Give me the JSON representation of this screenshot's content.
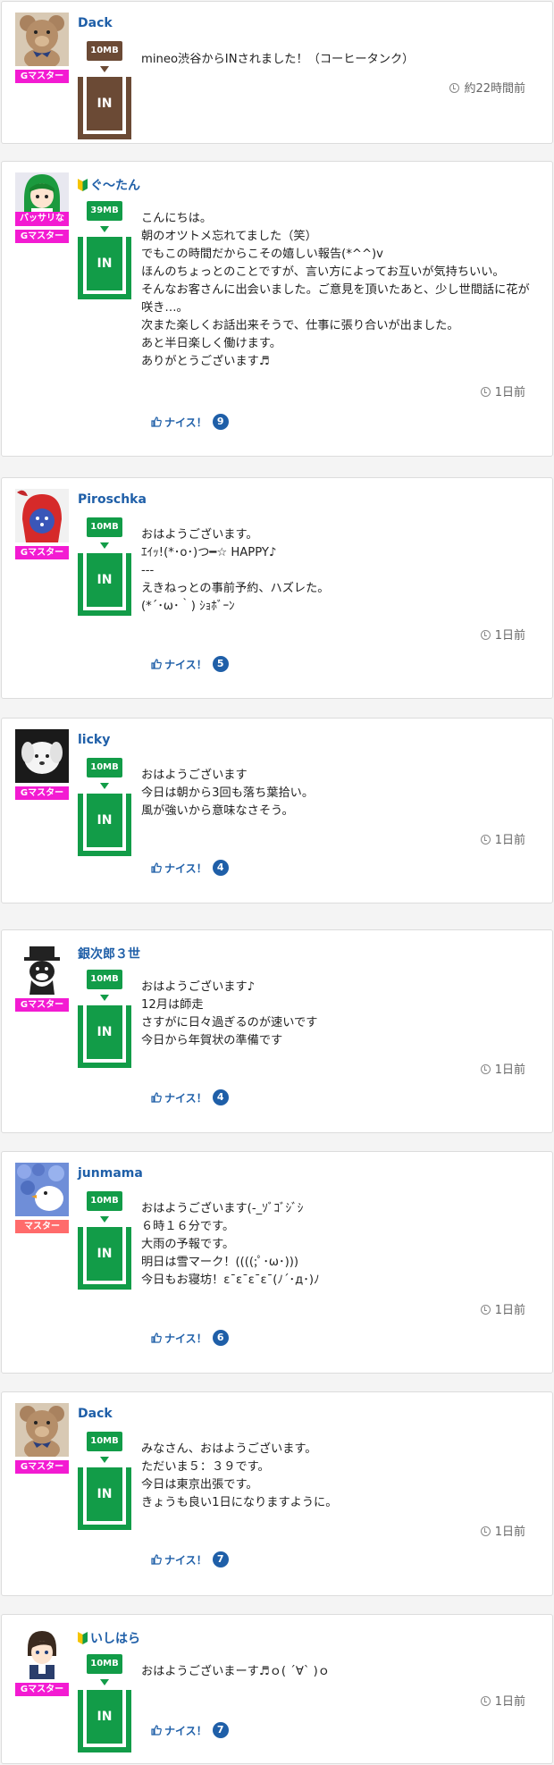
{
  "colors": {
    "link": "#1f5fa8",
    "in_green": "#129c48",
    "in_brown": "#6b4a35",
    "gmaster_magenta": "#f31bd2",
    "master_pink": "#ff6b6b"
  },
  "posts": [
    {
      "username": "Dack",
      "beginner": false,
      "avatar_icon": "teddy-bear-avatar",
      "avatar_caption": "",
      "rank": "Gマスター",
      "rank_color": "#f31bd2",
      "mb": "10MB",
      "mb_color": "#6b4a35",
      "in_label": "IN",
      "in_color": "#6b4a35",
      "message": "mineo渋谷からINされました！（コーヒータンク）",
      "time": "約22時間前",
      "nice_label": "",
      "nice_count": ""
    },
    {
      "username": "ぐ〜たん",
      "beginner": true,
      "avatar_icon": "green-hair-girl-avatar",
      "avatar_caption": "バッサリな",
      "rank": "Gマスター",
      "rank_color": "#f31bd2",
      "mb": "39MB",
      "mb_color": "#129c48",
      "in_label": "IN",
      "in_color": "#129c48",
      "message": "こんにちは。\n朝のオツトメ忘れてました（笑）\nでもこの時間だからこその嬉しい報告(*^^)v\nほんのちょっとのことですが、言い方によってお互いが気持ちいい。\nそんなお客さんに出会いました。ご意見を頂いたあと、少し世間話に花が咲き…。\n次また楽しくお話出来そうで、仕事に張り合いが出ました。\nあと半日楽しく働けます。\nありがとうございます♬",
      "time": "1日前",
      "nice_label": "ナイス！",
      "nice_count": "9"
    },
    {
      "username": "Piroschka",
      "beginner": false,
      "avatar_icon": "red-hood-avatar",
      "avatar_caption": "",
      "rank": "Gマスター",
      "rank_color": "#f31bd2",
      "mb": "10MB",
      "mb_color": "#129c48",
      "in_label": "IN",
      "in_color": "#129c48",
      "message": "おはようございます。\nｴｲｯ!(*･o･)つ━☆ HAPPY♪\n---\nえきねっとの事前予約、ハズレた。\n(*´･ω･｀) ｼｮﾎﾞｰﾝ",
      "time": "1日前",
      "nice_label": "ナイス！",
      "nice_count": "5"
    },
    {
      "username": "licky",
      "beginner": false,
      "avatar_icon": "white-dog-avatar",
      "avatar_caption": "",
      "rank": "Gマスター",
      "rank_color": "#f31bd2",
      "mb": "10MB",
      "mb_color": "#129c48",
      "in_label": "IN",
      "in_color": "#129c48",
      "message": "おはようございます\n今日は朝から3回も落ち葉拾い。\n風が強いから意味なさそう。",
      "time": "1日前",
      "nice_label": "ナイス！",
      "nice_count": "4"
    },
    {
      "username": "銀次郎３世",
      "beginner": false,
      "avatar_icon": "black-cat-hat-avatar",
      "avatar_caption": "",
      "rank": "Gマスター",
      "rank_color": "#f31bd2",
      "mb": "10MB",
      "mb_color": "#129c48",
      "in_label": "IN",
      "in_color": "#129c48",
      "message": "おはようございます♪\n12月は師走\nさすがに日々過ぎるのが速いです\n今日から年賀状の準備です",
      "time": "1日前",
      "nice_label": "ナイス！",
      "nice_count": "4"
    },
    {
      "username": "junmama",
      "beginner": false,
      "avatar_icon": "hydrangea-duck-avatar",
      "avatar_caption": "",
      "rank": "マスター",
      "rank_color": "#ff6b6b",
      "mb": "10MB",
      "mb_color": "#129c48",
      "in_label": "IN",
      "in_color": "#129c48",
      "message": "おはようございます(-_ｿﾞｺﾞｼﾞｼ\n６時１６分です。\n大雨の予報です。\n明日は雪マーク！((((;ﾟ･ω･)))\n今日もお寝坊！ε¯ε¯ε¯ε¯(ﾉ´･д･)ﾉ",
      "time": "1日前",
      "nice_label": "ナイス！",
      "nice_count": "6"
    },
    {
      "username": "Dack",
      "beginner": false,
      "avatar_icon": "teddy-bear-avatar",
      "avatar_caption": "",
      "rank": "Gマスター",
      "rank_color": "#f31bd2",
      "mb": "10MB",
      "mb_color": "#129c48",
      "in_label": "IN",
      "in_color": "#129c48",
      "message": "みなさん、おはようございます。\nただいま５：３９です。\n今日は東京出張です。\nきょうも良い1日になりますように。",
      "time": "1日前",
      "nice_label": "ナイス！",
      "nice_count": "7"
    },
    {
      "username": "いしはら",
      "beginner": true,
      "avatar_icon": "anime-boy-avatar",
      "avatar_caption": "",
      "rank": "Gマスター",
      "rank_color": "#f31bd2",
      "mb": "10MB",
      "mb_color": "#129c48",
      "in_label": "IN",
      "in_color": "#129c48",
      "message": "おはようございまーす♬ｏ( ´∀` )ｏ",
      "time": "1日前",
      "nice_label": "ナイス！",
      "nice_count": "7"
    }
  ]
}
